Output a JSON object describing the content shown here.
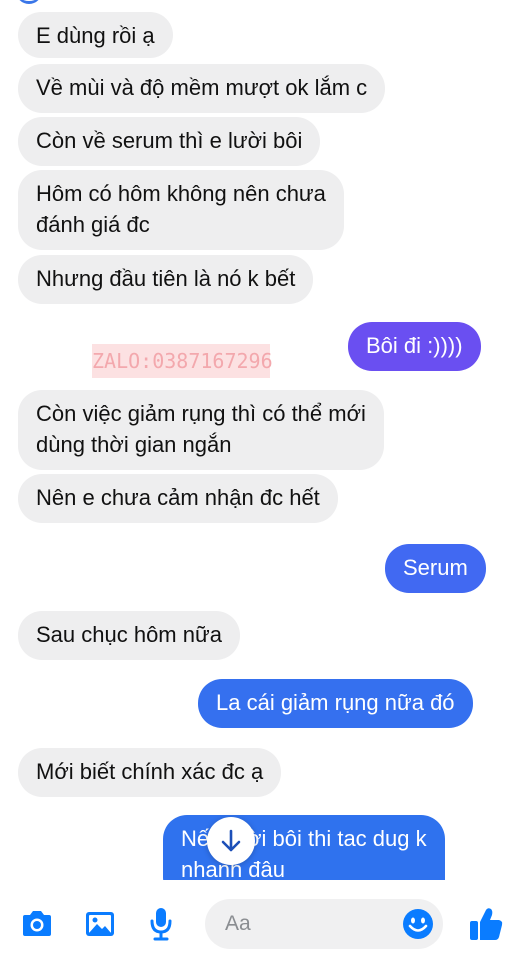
{
  "colors": {
    "incoming_bubble": "#eeeeef",
    "outgoing_gradient_top": "#7b4cf0",
    "outgoing_mid": "#4a5ff2",
    "outgoing_bottom": "#2f72ee",
    "accent_icon": "#0a7cff"
  },
  "watermark": "ZALO:0387167296",
  "messages": [
    {
      "direction": "in",
      "lines": [
        "E dùng rồi ạ"
      ]
    },
    {
      "direction": "in",
      "lines": [
        "Về mùi và độ mềm mượt ok lắm c"
      ]
    },
    {
      "direction": "in",
      "lines": [
        "Còn về serum thì e lười bôi"
      ]
    },
    {
      "direction": "in",
      "lines": [
        "Hôm có hôm không nên chưa",
        "đánh giá đc"
      ]
    },
    {
      "direction": "in",
      "lines": [
        "Nhưng đầu tiên là nó k bết"
      ]
    },
    {
      "direction": "out",
      "lines": [
        "Bôi đi :))))"
      ]
    },
    {
      "direction": "in",
      "lines": [
        "Còn việc giảm rụng thì có thể mới",
        "dùng thời gian ngắn"
      ]
    },
    {
      "direction": "in",
      "lines": [
        "Nên e chưa cảm nhận đc hết"
      ]
    },
    {
      "direction": "out",
      "lines": [
        "Serum"
      ]
    },
    {
      "direction": "in",
      "lines": [
        "Sau chục hôm nữa"
      ]
    },
    {
      "direction": "out",
      "lines": [
        "La cái giảm rụng nữa đó"
      ]
    },
    {
      "direction": "in",
      "lines": [
        "Mới biết chính xác đc ạ"
      ]
    },
    {
      "direction": "out",
      "lines": [
        "Nếu lười bôi thi tac dug k",
        "nhanh đâu"
      ]
    }
  ],
  "composer": {
    "placeholder": "Aa",
    "icons": [
      "camera-icon",
      "gallery-icon",
      "microphone-icon",
      "emoji-icon",
      "thumbs-up-icon"
    ]
  },
  "scroll_button_icon": "arrow-down-icon"
}
